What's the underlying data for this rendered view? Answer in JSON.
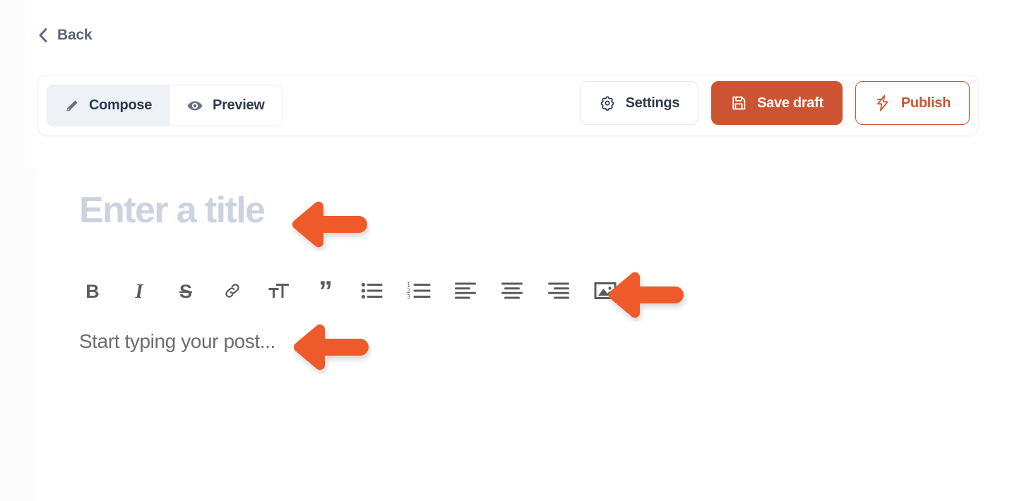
{
  "nav": {
    "back_label": "Back",
    "back_icon": "chevron-left-icon"
  },
  "toolbar": {
    "tabs": [
      {
        "label": "Compose",
        "icon": "pencil-icon",
        "active": true
      },
      {
        "label": "Preview",
        "icon": "eye-icon",
        "active": false
      }
    ],
    "actions": [
      {
        "label": "Settings",
        "icon": "gear-icon",
        "style": "ghost"
      },
      {
        "label": "Save draft",
        "icon": "floppy-disk-icon",
        "style": "primary"
      },
      {
        "label": "Publish",
        "icon": "lightning-bolt-icon",
        "style": "outline"
      }
    ]
  },
  "editor": {
    "title_placeholder": "Enter a title",
    "body_placeholder": "Start typing your post...",
    "format_buttons": [
      {
        "name": "bold",
        "glyph": "B"
      },
      {
        "name": "italic",
        "glyph": "I"
      },
      {
        "name": "strikethrough",
        "glyph": "S"
      },
      {
        "name": "link",
        "glyph": ""
      },
      {
        "name": "text-size",
        "glyph": ""
      },
      {
        "name": "blockquote",
        "glyph": "”"
      },
      {
        "name": "bulleted-list",
        "glyph": ""
      },
      {
        "name": "numbered-list",
        "glyph": ""
      },
      {
        "name": "align-left",
        "glyph": ""
      },
      {
        "name": "align-center",
        "glyph": ""
      },
      {
        "name": "align-right",
        "glyph": ""
      },
      {
        "name": "insert-image",
        "glyph": ""
      }
    ]
  },
  "annotations": {
    "arrow_color": "#ef5a2a",
    "arrows": [
      {
        "target": "title-placeholder",
        "direction": "left"
      },
      {
        "target": "insert-image-button",
        "direction": "left"
      },
      {
        "target": "body-placeholder",
        "direction": "left"
      }
    ]
  },
  "colors": {
    "accent": "#cd5433",
    "arrow": "#ef5a2a",
    "text_dark": "#2f3a4f",
    "text_muted": "#5a6478",
    "placeholder_title": "#ccd3df",
    "placeholder_body": "#6d6d6d",
    "card_border": "#eef0f4",
    "tab_active_bg": "#eef1f6"
  }
}
